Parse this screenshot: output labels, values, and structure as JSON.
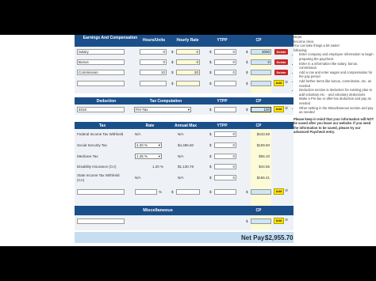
{
  "earnings": {
    "headers": [
      "Earnings And Compensation",
      "Hours/Units",
      "Hourly Rate",
      "YTPP",
      "CP"
    ],
    "rows": [
      {
        "label": "Salary",
        "hours": "0",
        "rate": "0",
        "ytd": "0",
        "cp": "3000",
        "action": "Delete"
      },
      {
        "label": "Bonus",
        "hours": "0",
        "rate": "0",
        "ytd": "0",
        "cp": "0",
        "action": "Delete"
      },
      {
        "label": "Commission",
        "hours": "10",
        "rate": "20",
        "ytd": "0",
        "cp": "",
        "action": "Delete"
      },
      {
        "label": "",
        "hours": "",
        "rate": "",
        "ytd": "",
        "cp": "",
        "action": "Add"
      }
    ]
  },
  "deductions": {
    "headers": [
      "Deduction",
      "Tax Computation",
      "YTPP",
      "CP"
    ],
    "rows": [
      {
        "label": "401K",
        "computation": "Pre-Tax",
        "ytd": "",
        "cp": "100",
        "action": "Add"
      }
    ]
  },
  "taxes": {
    "headers": [
      "Tax",
      "Rate",
      "Annual Max",
      "YTPP",
      "CP"
    ],
    "rows": [
      {
        "label": "Federal Income Tax Withheld",
        "rate": "N/A",
        "max": "N/A",
        "ytd": "0",
        "cp": "$443.59"
      },
      {
        "label": "Social Security Tax",
        "rate": "4.20 %",
        "max": "$4,485.60",
        "ytd": "0",
        "cp": "$159.60"
      },
      {
        "label": "Medicare Tax",
        "rate": "1.45 %",
        "max": "N/A",
        "ytd": "0",
        "cp": "$55.10"
      },
      {
        "label": "Disability Insurance (CA)",
        "rate": "1.20 %",
        "max": "$1,130.78",
        "ytd": "0",
        "cp": "$44.55"
      },
      {
        "label": "State Income Tax Withheld (CA)",
        "rate": "N/A",
        "max": "N/A",
        "ytd": "0",
        "cp": "$156.41"
      },
      {
        "label": "",
        "rate": "",
        "max": "%",
        "ytd": "",
        "cp": "",
        "action": "Add"
      }
    ]
  },
  "misc": {
    "header": "Miscellaneous",
    "cp_header": "CP",
    "action": "Add"
  },
  "net_pay": {
    "label": "Net Pay:",
    "value": "$2,955.70"
  },
  "side": {
    "top_lines": [
      "steps:",
      "become clear.",
      "You can take things a bit easier",
      "following:"
    ],
    "bullets": [
      "Enter company and employee information to begin preparing the paycheck",
      "Enter in a information like salary, bonus, commission",
      "Add a row and enter wages and compensation for the pay period",
      "Add further items like bonus, commission, etc. as needed",
      "Deduction section is deduction for existing plan to add voluntary etc. - and voluntary deductions",
      "Make a Pre-tax or after-tax deduction and pay as needed",
      "Other setting in the Miscellaneous section and pay as needed"
    ],
    "bottom": "Please keep in mind that your information will NOT be saved after you leave our website. If you need the information to be saved, please try our advanced Paycheck entry."
  }
}
